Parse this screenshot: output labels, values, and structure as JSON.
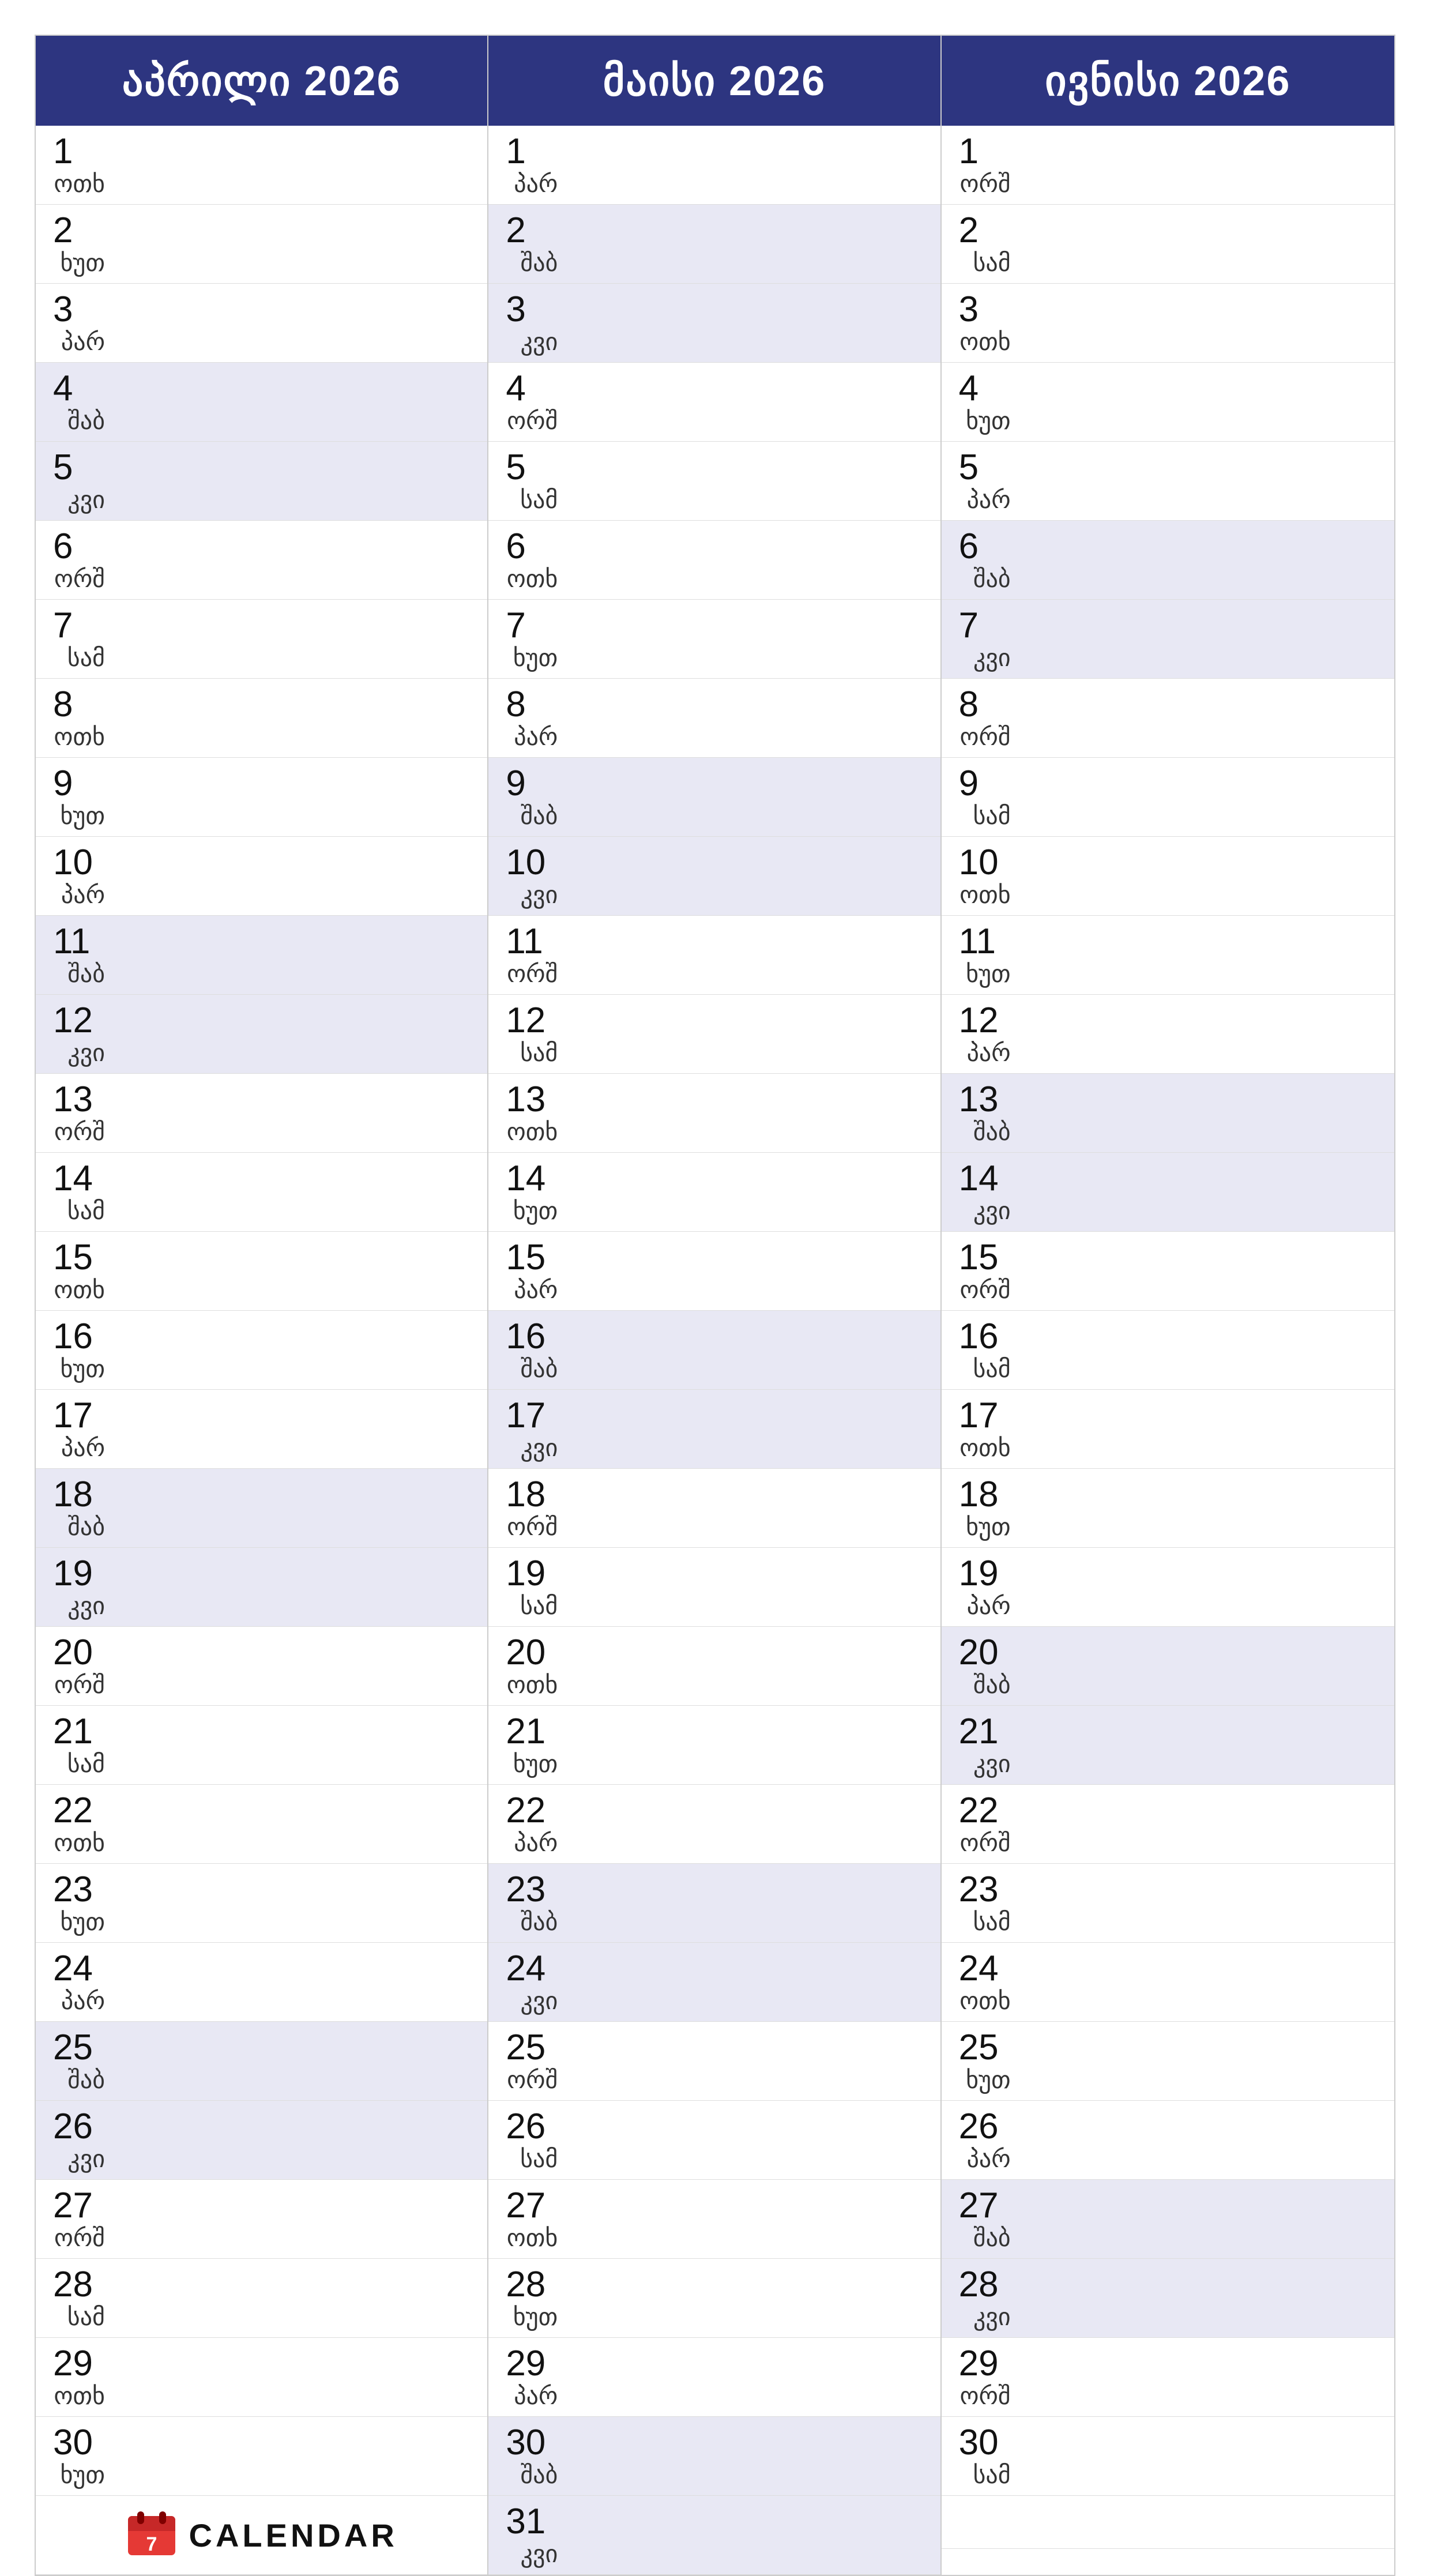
{
  "months": [
    {
      "name": "აპრილი 2026",
      "days": [
        {
          "num": "1",
          "name": "ოთხ"
        },
        {
          "num": "2",
          "name": "ხუთ"
        },
        {
          "num": "3",
          "name": "პარ"
        },
        {
          "num": "4",
          "name": "შაბ"
        },
        {
          "num": "5",
          "name": "კვი"
        },
        {
          "num": "6",
          "name": "ორშ"
        },
        {
          "num": "7",
          "name": "სამ"
        },
        {
          "num": "8",
          "name": "ოთხ"
        },
        {
          "num": "9",
          "name": "ხუთ"
        },
        {
          "num": "10",
          "name": "პარ"
        },
        {
          "num": "11",
          "name": "შაბ"
        },
        {
          "num": "12",
          "name": "კვი"
        },
        {
          "num": "13",
          "name": "ორშ"
        },
        {
          "num": "14",
          "name": "სამ"
        },
        {
          "num": "15",
          "name": "ოთხ"
        },
        {
          "num": "16",
          "name": "ხუთ"
        },
        {
          "num": "17",
          "name": "პარ"
        },
        {
          "num": "18",
          "name": "შაბ"
        },
        {
          "num": "19",
          "name": "კვი"
        },
        {
          "num": "20",
          "name": "ორშ"
        },
        {
          "num": "21",
          "name": "სამ"
        },
        {
          "num": "22",
          "name": "ოთხ"
        },
        {
          "num": "23",
          "name": "ხუთ"
        },
        {
          "num": "24",
          "name": "პარ"
        },
        {
          "num": "25",
          "name": "შაბ"
        },
        {
          "num": "26",
          "name": "კვი"
        },
        {
          "num": "27",
          "name": "ორშ"
        },
        {
          "num": "28",
          "name": "სამ"
        },
        {
          "num": "29",
          "name": "ოთხ"
        },
        {
          "num": "30",
          "name": "ხუთ"
        }
      ],
      "shaded": [
        4,
        5,
        11,
        12,
        18,
        19,
        25,
        26
      ]
    },
    {
      "name": "მაისი 2026",
      "days": [
        {
          "num": "1",
          "name": "პარ"
        },
        {
          "num": "2",
          "name": "შაბ"
        },
        {
          "num": "3",
          "name": "კვი"
        },
        {
          "num": "4",
          "name": "ორშ"
        },
        {
          "num": "5",
          "name": "სამ"
        },
        {
          "num": "6",
          "name": "ოთხ"
        },
        {
          "num": "7",
          "name": "ხუთ"
        },
        {
          "num": "8",
          "name": "პარ"
        },
        {
          "num": "9",
          "name": "შაბ"
        },
        {
          "num": "10",
          "name": "კვი"
        },
        {
          "num": "11",
          "name": "ორშ"
        },
        {
          "num": "12",
          "name": "სამ"
        },
        {
          "num": "13",
          "name": "ოთხ"
        },
        {
          "num": "14",
          "name": "ხუთ"
        },
        {
          "num": "15",
          "name": "პარ"
        },
        {
          "num": "16",
          "name": "შაბ"
        },
        {
          "num": "17",
          "name": "კვი"
        },
        {
          "num": "18",
          "name": "ორშ"
        },
        {
          "num": "19",
          "name": "სამ"
        },
        {
          "num": "20",
          "name": "ოთხ"
        },
        {
          "num": "21",
          "name": "ხუთ"
        },
        {
          "num": "22",
          "name": "პარ"
        },
        {
          "num": "23",
          "name": "შაბ"
        },
        {
          "num": "24",
          "name": "კვი"
        },
        {
          "num": "25",
          "name": "ორშ"
        },
        {
          "num": "26",
          "name": "სამ"
        },
        {
          "num": "27",
          "name": "ოთხ"
        },
        {
          "num": "28",
          "name": "ხუთ"
        },
        {
          "num": "29",
          "name": "პარ"
        },
        {
          "num": "30",
          "name": "შაბ"
        },
        {
          "num": "31",
          "name": "კვი"
        }
      ],
      "shaded": [
        2,
        3,
        9,
        10,
        16,
        17,
        23,
        24,
        30,
        31
      ]
    },
    {
      "name": "ივნისი 2026",
      "days": [
        {
          "num": "1",
          "name": "ორშ"
        },
        {
          "num": "2",
          "name": "სამ"
        },
        {
          "num": "3",
          "name": "ოთხ"
        },
        {
          "num": "4",
          "name": "ხუთ"
        },
        {
          "num": "5",
          "name": "პარ"
        },
        {
          "num": "6",
          "name": "შაბ"
        },
        {
          "num": "7",
          "name": "კვი"
        },
        {
          "num": "8",
          "name": "ორშ"
        },
        {
          "num": "9",
          "name": "სამ"
        },
        {
          "num": "10",
          "name": "ოთხ"
        },
        {
          "num": "11",
          "name": "ხუთ"
        },
        {
          "num": "12",
          "name": "პარ"
        },
        {
          "num": "13",
          "name": "შაბ"
        },
        {
          "num": "14",
          "name": "კვი"
        },
        {
          "num": "15",
          "name": "ორშ"
        },
        {
          "num": "16",
          "name": "სამ"
        },
        {
          "num": "17",
          "name": "ოთხ"
        },
        {
          "num": "18",
          "name": "ხუთ"
        },
        {
          "num": "19",
          "name": "პარ"
        },
        {
          "num": "20",
          "name": "შაბ"
        },
        {
          "num": "21",
          "name": "კვი"
        },
        {
          "num": "22",
          "name": "ორშ"
        },
        {
          "num": "23",
          "name": "სამ"
        },
        {
          "num": "24",
          "name": "ოთხ"
        },
        {
          "num": "25",
          "name": "ხუთ"
        },
        {
          "num": "26",
          "name": "პარ"
        },
        {
          "num": "27",
          "name": "შაბ"
        },
        {
          "num": "28",
          "name": "კვი"
        },
        {
          "num": "29",
          "name": "ორშ"
        },
        {
          "num": "30",
          "name": "სამ"
        }
      ],
      "shaded": [
        6,
        7,
        13,
        14,
        20,
        21,
        27,
        28
      ]
    }
  ],
  "logo": {
    "text": "CALENDAR"
  }
}
